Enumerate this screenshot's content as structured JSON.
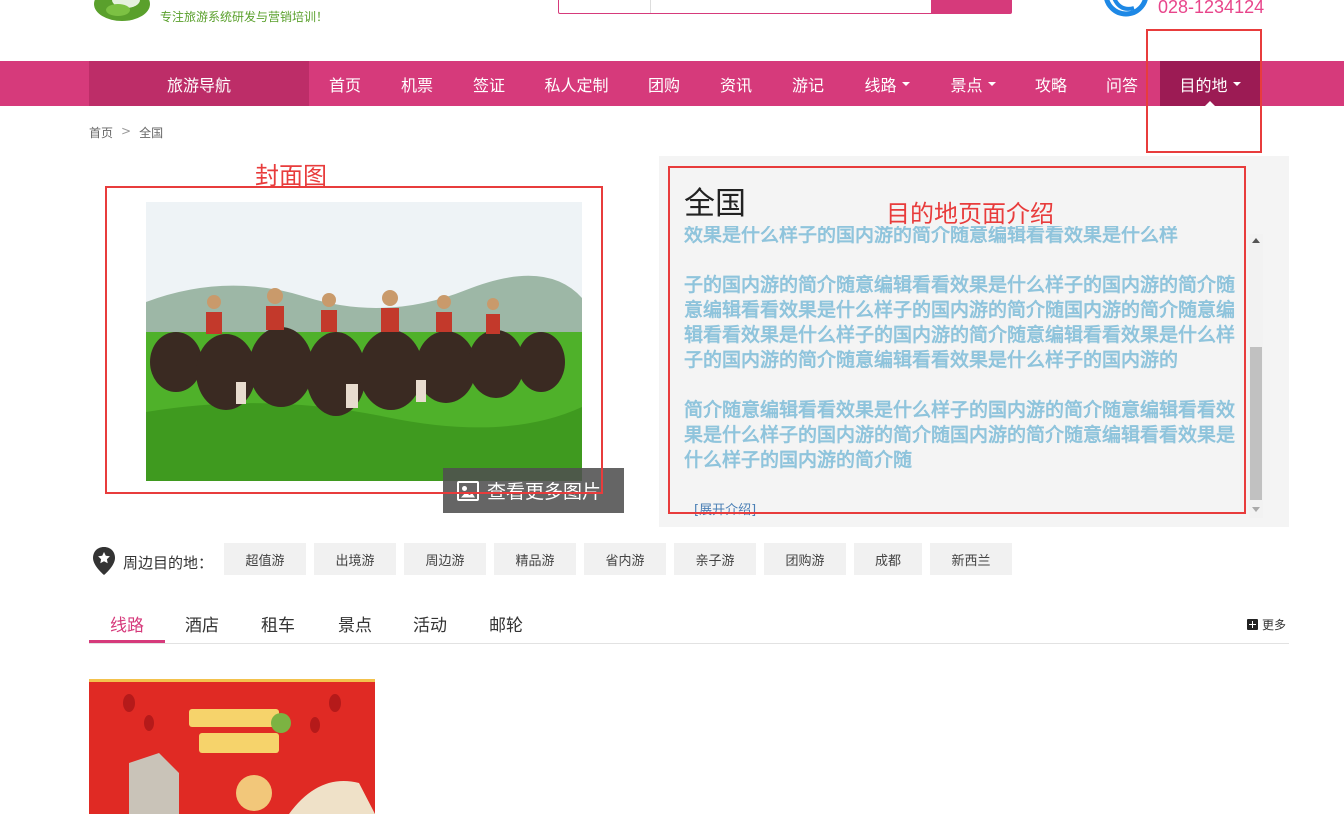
{
  "header": {
    "tagline": "专注旅游系统研发与营销培训！",
    "header_link": "",
    "search": {
      "type": "",
      "placeholder": "",
      "button": ""
    },
    "phone": "028-1234124"
  },
  "nav": {
    "guide": "旅游导航",
    "items": [
      {
        "label": "首页",
        "dropdown": false
      },
      {
        "label": "机票",
        "dropdown": false
      },
      {
        "label": "签证",
        "dropdown": false
      },
      {
        "label": "私人定制",
        "dropdown": false
      },
      {
        "label": "团购",
        "dropdown": false
      },
      {
        "label": "资讯",
        "dropdown": false
      },
      {
        "label": "游记",
        "dropdown": false
      },
      {
        "label": "线路",
        "dropdown": true
      },
      {
        "label": "景点",
        "dropdown": true
      },
      {
        "label": "攻略",
        "dropdown": false
      },
      {
        "label": "问答",
        "dropdown": false
      },
      {
        "label": "目的地",
        "dropdown": true,
        "active": true
      }
    ]
  },
  "breadcrumb": {
    "home": "首页",
    "sep": ">",
    "current": "全国"
  },
  "annotations": {
    "cover": "封面图",
    "intro": "目的地页面介绍"
  },
  "cover": {
    "more_pics": "查看更多图片"
  },
  "intro": {
    "title": "全国",
    "paragraphs": [
      "效果是什么样子的国内游的简介随意编辑看看效果是什么样",
      "子的国内游的简介随意编辑看看效果是什么样子的国内游的简介随意编辑看看效果是什么样子的国内游的简介随国内游的简介随意编辑看看效果是什么样子的国内游的简介随意编辑看看效果是什么样子的国内游的简介随意编辑看看效果是什么样子的国内游的",
      "简介随意编辑看看效果是什么样子的国内游的简介随意编辑看看效果是什么样子的国内游的简介随国内游的简介随意编辑看看效果是什么样子的国内游的简介随"
    ],
    "expand": "[展开介绍]"
  },
  "nearby": {
    "label": "周边目的地：",
    "tags": [
      "超值游",
      "出境游",
      "周边游",
      "精品游",
      "省内游",
      "亲子游",
      "团购游",
      "成都",
      "新西兰"
    ]
  },
  "tabs": {
    "items": [
      "线路",
      "酒店",
      "租车",
      "景点",
      "活动",
      "邮轮"
    ],
    "active": "线路",
    "more": "更多"
  },
  "colors": {
    "brand": "#d63a7b",
    "brand_dark": "#bd2d68",
    "active": "#9c1b54",
    "intro_text": "#8fc4dc",
    "annotation": "#e83c3c"
  }
}
